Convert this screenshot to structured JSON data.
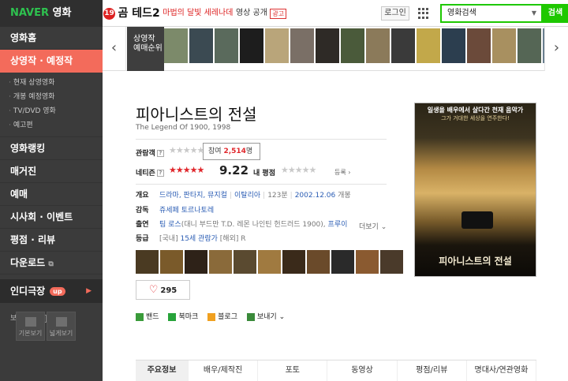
{
  "header": {
    "logo_brand": "NAVER",
    "logo_section": "영화",
    "promo_rating": "19",
    "promo_title": "곰 테드2",
    "promo_sub": "마법의 달빛 세레나데",
    "promo_video": "영상 공개",
    "promo_badge": "광고",
    "login_label": "로그인",
    "search_category": "영화검색",
    "search_button": "검색"
  },
  "sidebar": {
    "items": [
      {
        "label": "영화홈"
      },
      {
        "label": "상영작 · 예정작"
      },
      {
        "label": "영화랭킹"
      },
      {
        "label": "매거진"
      },
      {
        "label": "예매"
      },
      {
        "label": "시사회 · 이벤트"
      },
      {
        "label": "평점 · 리뷰"
      },
      {
        "label": "다운로드"
      }
    ],
    "subitems": [
      {
        "label": "현재 상영영화"
      },
      {
        "label": "개봉 예정영화"
      },
      {
        "label": "TV/DVD 영화"
      },
      {
        "label": "예고편"
      }
    ],
    "indie_label": "인디극장",
    "indie_badge": "up",
    "view_options_label": "보기옵션",
    "view_basic": "기본보기",
    "view_wide": "넓게보기"
  },
  "strip": {
    "label_line1": "상영작",
    "label_line2": "예매순위",
    "thumb_colors": [
      "#7c8a6a",
      "#3b4a52",
      "#5a6a5c",
      "#1d1d1d",
      "#b9a57a",
      "#7a6f66",
      "#2e2a26",
      "#4a5a3a",
      "#8b7a5a",
      "#3a3a3a",
      "#c2a84a",
      "#2c3e4f",
      "#6b4a3a",
      "#a89060",
      "#556655",
      "#6a7f8f"
    ]
  },
  "movie": {
    "title": "피아니스트의 전설",
    "subtitle": "The Legend Of 1900, 1998",
    "audience_label": "관람객",
    "tooltip_prefix": "참여",
    "tooltip_count": "2,514",
    "tooltip_suffix": "명",
    "netizen_label": "네티즌",
    "netizen_score": "9.22",
    "my_rating_label": "내 평점",
    "register_label": "등록",
    "overview_label": "개요",
    "genres": "드라마, 판타지, 뮤지컬",
    "country": "이탈리아",
    "runtime": "123분",
    "release": "2002.12.06",
    "release_suffix": "개봉",
    "director_label": "감독",
    "director": "쥬세페 토르나토레",
    "cast_label": "출연",
    "cast_main": "팀 로스",
    "cast_rest": "(대니 부드만 T.D. 레몬 나인틴 헌드러드 1900),",
    "cast_next": "프루이",
    "more_label": "더보기",
    "grade_label": "등급",
    "grade_region": "[국내]",
    "grade_value": "15세 관람가",
    "grade_overseas": "[해외]",
    "grade_overseas_value": "R",
    "like_count": "295",
    "poster_tagline1": "일생을 배우에서 살다간 천재 음악가",
    "poster_tagline2": "그가 거대한 세상을 연주한다!",
    "poster_title": "피아니스트의 전설",
    "still_colors": [
      "#4a3a22",
      "#7a5a2a",
      "#2e2218",
      "#8a6a3a",
      "#5a4a30",
      "#a07a40",
      "#3a2a1a",
      "#6a4a2a",
      "#2a2a2a",
      "#8a5a30",
      "#4a3a2a"
    ]
  },
  "share": {
    "items": [
      {
        "label": "밴드",
        "color": "#3a9b3a"
      },
      {
        "label": "북마크",
        "color": "#27a33a"
      },
      {
        "label": "블로그",
        "color": "#f0a020"
      },
      {
        "label": "보내기",
        "color": "#3a8a3a"
      }
    ]
  },
  "tabs": [
    {
      "label": "주요정보"
    },
    {
      "label": "배우/제작진"
    },
    {
      "label": "포토"
    },
    {
      "label": "동영상"
    },
    {
      "label": "평점/리뷰"
    },
    {
      "label": "명대사/연관영화"
    }
  ],
  "colors": {
    "accent_red": "#e0262b",
    "naver_green": "#1ec800",
    "active_nav": "#f36b5b"
  }
}
